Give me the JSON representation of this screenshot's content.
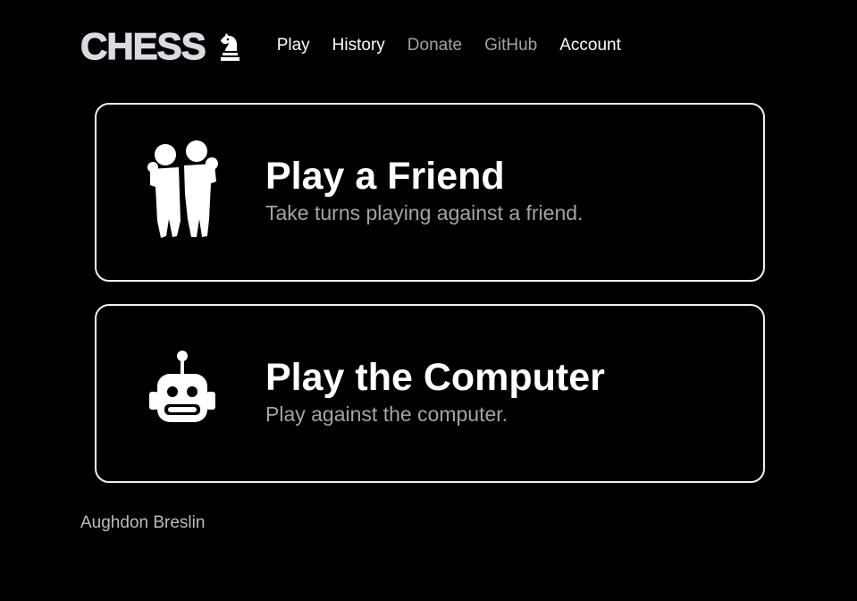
{
  "brand": {
    "name": "CHESS",
    "icon": "chess-knight-icon"
  },
  "nav": {
    "items": [
      {
        "label": "Play",
        "style": "bright"
      },
      {
        "label": "History",
        "style": "bright"
      },
      {
        "label": "Donate",
        "style": "dim"
      },
      {
        "label": "GitHub",
        "style": "dim"
      },
      {
        "label": "Account",
        "style": "bright"
      }
    ]
  },
  "cards": [
    {
      "title": "Play a Friend",
      "subtitle": "Take turns playing against a friend.",
      "icon": "two-people-icon"
    },
    {
      "title": "Play the Computer",
      "subtitle": "Play against the computer.",
      "icon": "robot-icon"
    }
  ],
  "footer": {
    "author": "Aughdon Breslin"
  },
  "colors": {
    "background": "#000000",
    "text": "#ffffff",
    "muted": "#9da3ad",
    "card_border": "#f2f2f2",
    "logo": "#d8dbe2"
  }
}
